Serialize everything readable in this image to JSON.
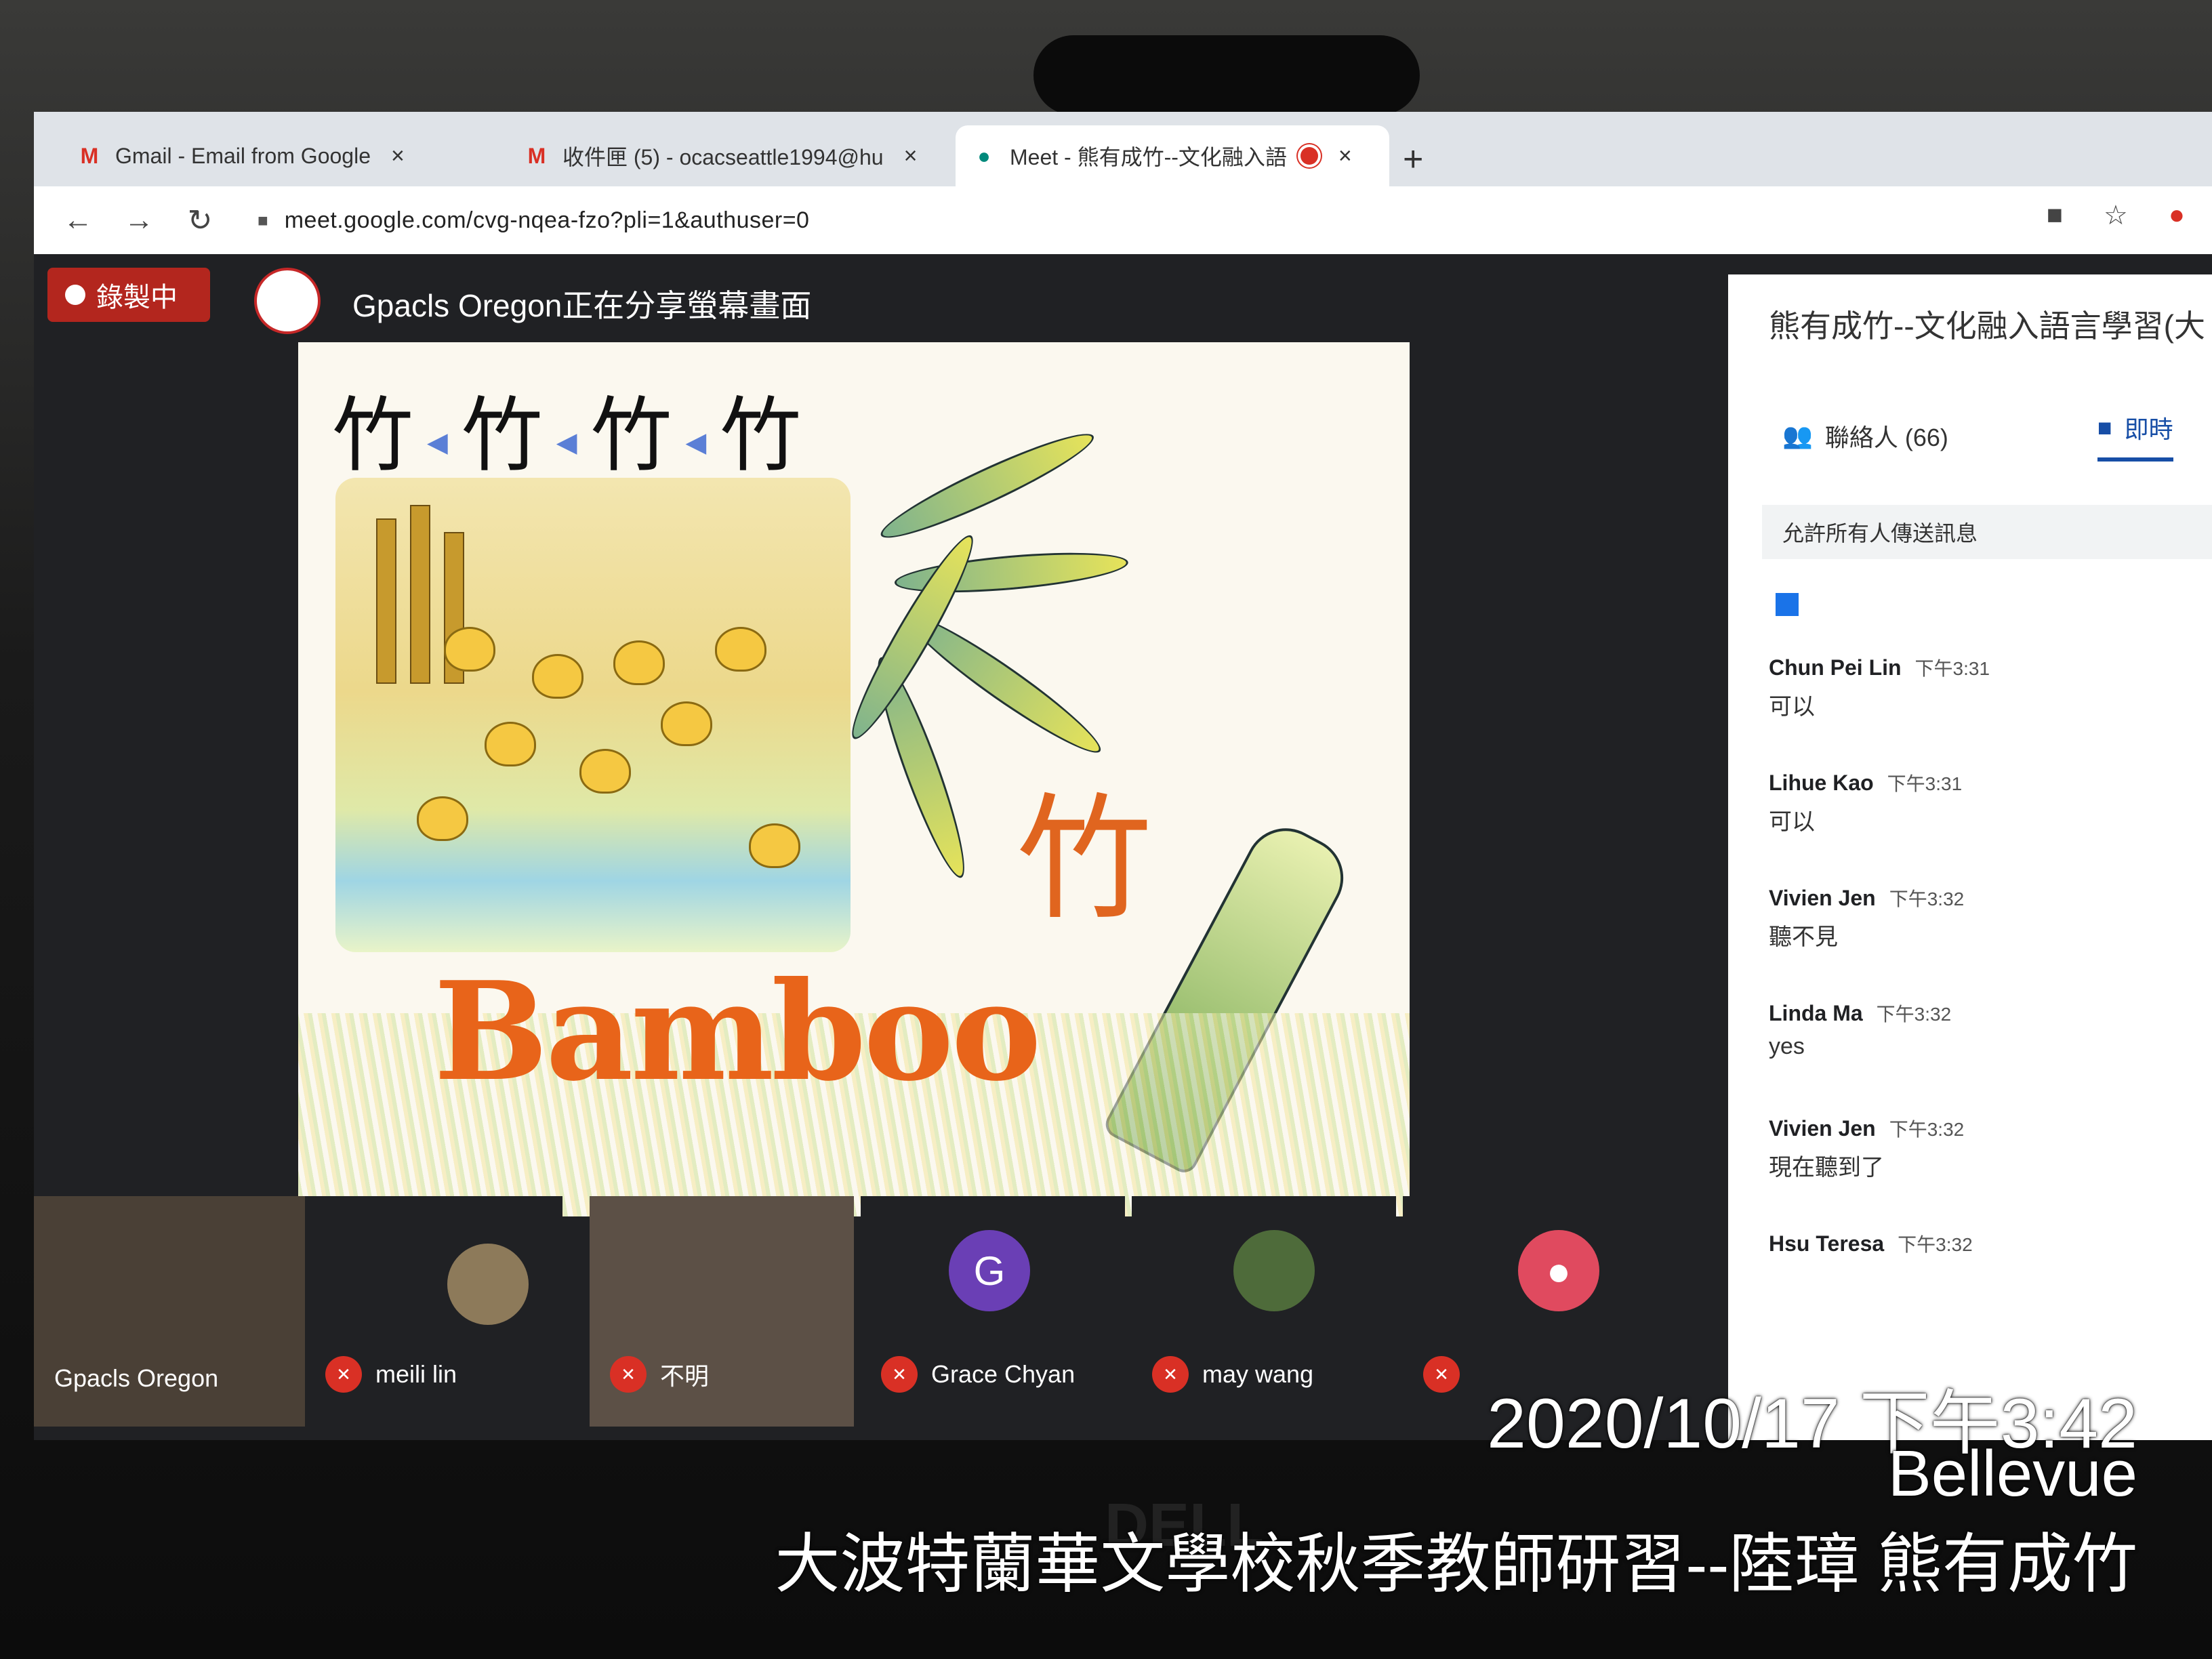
{
  "browser": {
    "tabs": [
      {
        "label": "Gmail - Email from Google",
        "icon": "gmail-icon",
        "active": false
      },
      {
        "label": "收件匣 (5) - ocacseattle1994@hu",
        "icon": "gmail-icon",
        "active": false
      },
      {
        "label": "Meet - 熊有成竹--文化融入語",
        "icon": "meet-icon",
        "active": true
      }
    ],
    "url": "meet.google.com/cvg-nqea-fzo?pli=1&authuser=0"
  },
  "meet": {
    "recording_label": "錄製中",
    "presenting_text": "Gpacls Oregon正在分享螢幕畫面",
    "slide": {
      "evolution": [
        "竹",
        "竹",
        "竹",
        "竹"
      ],
      "character": "竹",
      "word": "Bamboo"
    },
    "panel": {
      "title": "熊有成竹--文化融入語言學習(大",
      "people_tab": "聯絡人 (66)",
      "chat_tab": "即時",
      "allow_messages": "允許所有人傳送訊息",
      "messages": [
        {
          "sender": "Chun Pei Lin",
          "time": "下午3:31",
          "text": "可以"
        },
        {
          "sender": "Lihue Kao",
          "time": "下午3:31",
          "text": "可以"
        },
        {
          "sender": "Vivien Jen",
          "time": "下午3:32",
          "text": "聽不見"
        },
        {
          "sender": "Linda Ma",
          "time": "下午3:32",
          "text": "yes"
        },
        {
          "sender": "Vivien Jen",
          "time": "下午3:32",
          "text": "現在聽到了"
        },
        {
          "sender": "Hsu Teresa",
          "time": "下午3:32",
          "text": ""
        }
      ]
    },
    "participants": [
      {
        "name": "Gpacls Oregon",
        "muted": false
      },
      {
        "name": "meili lin",
        "muted": true
      },
      {
        "name": "不明",
        "muted": true
      },
      {
        "name": "Grace Chyan",
        "muted": true,
        "initial": "G"
      },
      {
        "name": "may wang",
        "muted": true
      },
      {
        "name": "",
        "muted": true
      }
    ],
    "colors": {
      "record": "#b3261e",
      "accent": "#174ea6",
      "meet_bg": "#202124",
      "slide_orange": "#e8641a"
    }
  },
  "photo_overlay": {
    "datetime": "2020/10/17 下午3:42",
    "location": "Bellevue",
    "caption": "大波特蘭華文學校秋季教師研習--陸璋 熊有成竹"
  }
}
